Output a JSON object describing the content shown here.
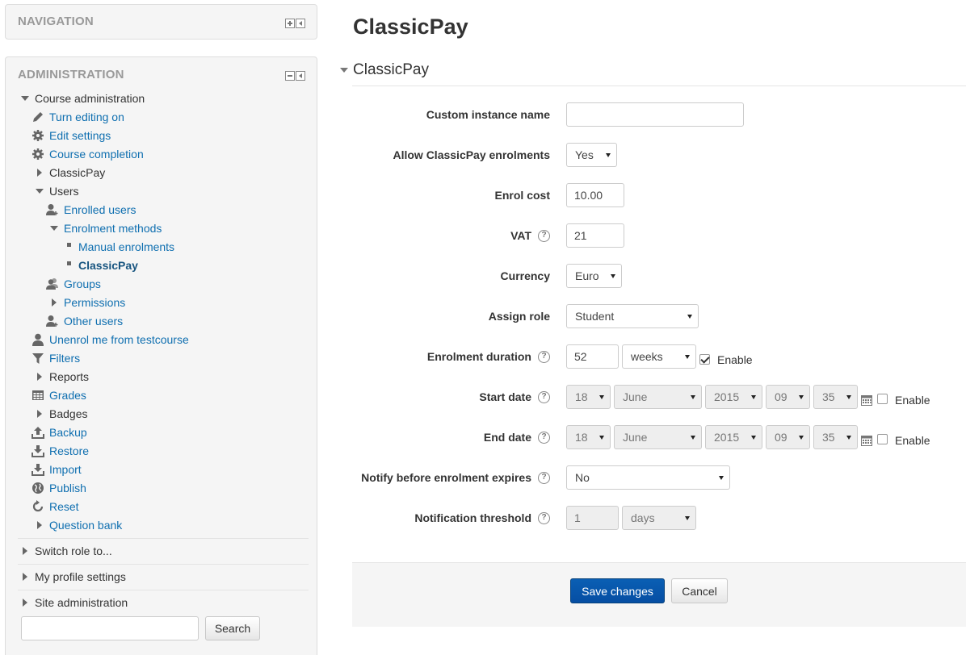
{
  "navigation_block": {
    "title": "NAVIGATION"
  },
  "admin_block": {
    "title": "ADMINISTRATION",
    "tree": {
      "course_admin": "Course administration",
      "turn_editing": "Turn editing on",
      "edit_settings": "Edit settings",
      "course_completion": "Course completion",
      "classicpay": "ClassicPay",
      "users": "Users",
      "enrolled_users": "Enrolled users",
      "enrolment_methods": "Enrolment methods",
      "manual_enrolments": "Manual enrolments",
      "classicpay_current": "ClassicPay",
      "groups": "Groups",
      "permissions": "Permissions",
      "other_users": "Other users",
      "unenrol": "Unenrol me from testcourse",
      "filters": "Filters",
      "reports": "Reports",
      "grades": "Grades",
      "badges": "Badges",
      "backup": "Backup",
      "restore": "Restore",
      "import": "Import",
      "publish": "Publish",
      "reset": "Reset",
      "question_bank": "Question bank",
      "switch_role": "Switch role to...",
      "my_profile": "My profile settings",
      "site_admin": "Site administration"
    },
    "search": {
      "value": "",
      "button": "Search"
    }
  },
  "main": {
    "page_title": "ClassicPay",
    "section_title": "ClassicPay",
    "fields": {
      "custom_name": {
        "label": "Custom instance name",
        "value": ""
      },
      "allow": {
        "label": "Allow ClassicPay enrolments",
        "value": "Yes"
      },
      "cost": {
        "label": "Enrol cost",
        "value": "10.00"
      },
      "vat": {
        "label": "VAT",
        "value": "21"
      },
      "currency": {
        "label": "Currency",
        "value": "Euro"
      },
      "role": {
        "label": "Assign role",
        "value": "Student"
      },
      "duration": {
        "label": "Enrolment duration",
        "value": "52",
        "unit": "weeks",
        "enable_label": "Enable",
        "enabled": true
      },
      "start_date": {
        "label": "Start date",
        "day": "18",
        "month": "June",
        "year": "2015",
        "hour": "09",
        "minute": "35",
        "enable_label": "Enable",
        "enabled": false
      },
      "end_date": {
        "label": "End date",
        "day": "18",
        "month": "June",
        "year": "2015",
        "hour": "09",
        "minute": "35",
        "enable_label": "Enable",
        "enabled": false
      },
      "notify": {
        "label": "Notify before enrolment expires",
        "value": "No"
      },
      "threshold": {
        "label": "Notification threshold",
        "value": "1",
        "unit": "days"
      }
    },
    "help_glyph": "?",
    "buttons": {
      "save": "Save changes",
      "cancel": "Cancel"
    }
  },
  "colors": {
    "link": "#0f6fb0",
    "primary_button": "#0a5fb4",
    "block_bg": "#f5f5f5"
  }
}
